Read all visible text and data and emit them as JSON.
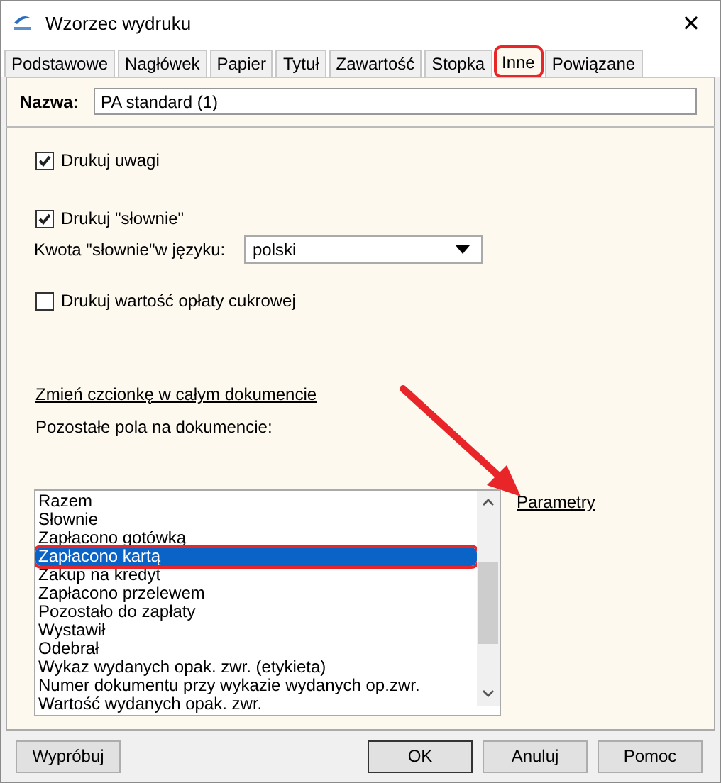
{
  "window": {
    "title": "Wzorzec wydruku",
    "close": "✕"
  },
  "tabs": [
    {
      "label": "Podstawowe",
      "selected": false,
      "highlighted": false
    },
    {
      "label": "Nagłówek",
      "selected": false,
      "highlighted": false
    },
    {
      "label": "Papier",
      "selected": false,
      "highlighted": false
    },
    {
      "label": "Tytuł",
      "selected": false,
      "highlighted": false
    },
    {
      "label": "Zawartość",
      "selected": false,
      "highlighted": false
    },
    {
      "label": "Stopka",
      "selected": false,
      "highlighted": false
    },
    {
      "label": "Inne",
      "selected": true,
      "highlighted": true
    },
    {
      "label": "Powiązane",
      "selected": false,
      "highlighted": false
    }
  ],
  "name_field": {
    "label": "Nazwa:",
    "value": "PA standard (1)"
  },
  "options": [
    {
      "kind": "checkbox",
      "label": "Drukuj uwagi",
      "checked": true
    },
    {
      "kind": "checkbox",
      "label": "Drukuj \"słownie\"",
      "checked": true
    },
    {
      "kind": "dropdown",
      "label": "Kwota \"słownie\"w języku:",
      "value": "polski"
    },
    {
      "kind": "checkbox",
      "label": "Drukuj wartość opłaty cukrowej",
      "checked": false
    }
  ],
  "font_link": "Zmień czcionkę w całym dokumencie ",
  "fields_label": "Pozostałe pola na dokumencie:",
  "fields_list": [
    {
      "label": "Razem",
      "selected": false,
      "highlighted": false
    },
    {
      "label": "Słownie",
      "selected": false,
      "highlighted": false
    },
    {
      "label": "Zapłacono gotówką",
      "selected": false,
      "highlighted": false
    },
    {
      "label": "Zapłacono kartą",
      "selected": true,
      "highlighted": true
    },
    {
      "label": "Zakup na kredyt",
      "selected": false,
      "highlighted": false
    },
    {
      "label": "Zapłacono przelewem",
      "selected": false,
      "highlighted": false
    },
    {
      "label": "Pozostało do zapłaty",
      "selected": false,
      "highlighted": false
    },
    {
      "label": "Wystawił",
      "selected": false,
      "highlighted": false
    },
    {
      "label": "Odebrał",
      "selected": false,
      "highlighted": false
    },
    {
      "label": "Wykaz wydanych opak. zwr. (etykieta)",
      "selected": false,
      "highlighted": false
    },
    {
      "label": "Numer dokumentu przy wykazie wydanych op.zwr.",
      "selected": false,
      "highlighted": false
    },
    {
      "label": "Wartość wydanych opak. zwr.",
      "selected": false,
      "highlighted": false
    }
  ],
  "params_link": "Parametry",
  "buttons": [
    {
      "label": "Wypróbuj",
      "kind": "left"
    },
    {
      "label": "OK",
      "kind": "default"
    },
    {
      "label": "Anuluj",
      "kind": "normal"
    },
    {
      "label": "Pomoc",
      "kind": "normal"
    }
  ]
}
